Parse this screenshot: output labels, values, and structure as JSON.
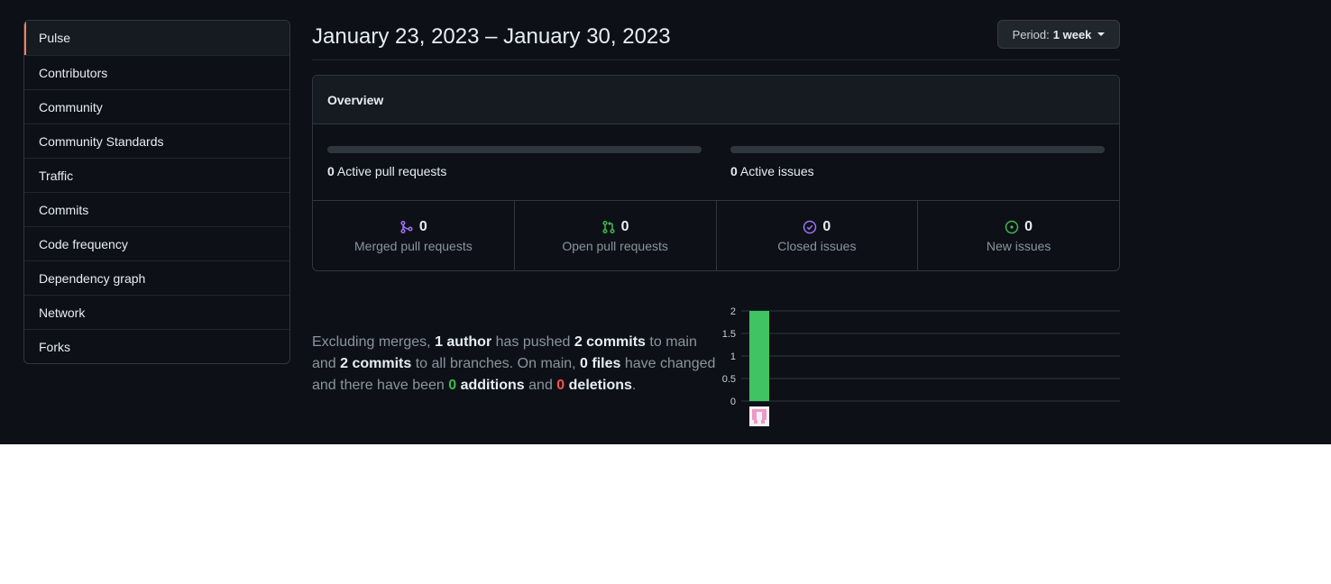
{
  "sidebar": {
    "items": [
      {
        "label": "Pulse"
      },
      {
        "label": "Contributors"
      },
      {
        "label": "Community"
      },
      {
        "label": "Community Standards"
      },
      {
        "label": "Traffic"
      },
      {
        "label": "Commits"
      },
      {
        "label": "Code frequency"
      },
      {
        "label": "Dependency graph"
      },
      {
        "label": "Network"
      },
      {
        "label": "Forks"
      }
    ],
    "selected": "Pulse"
  },
  "header": {
    "date_range": "January 23, 2023 – January 30, 2023",
    "period_label": "Period:",
    "period_value": "1 week"
  },
  "overview": {
    "title": "Overview",
    "active_prs_count": "0",
    "active_prs_label": "Active pull requests",
    "active_issues_count": "0",
    "active_issues_label": "Active issues",
    "stats": [
      {
        "count": "0",
        "label": "Merged pull requests",
        "icon": "git-merge-icon",
        "color": "#a371f7"
      },
      {
        "count": "0",
        "label": "Open pull requests",
        "icon": "git-pull-request-icon",
        "color": "#3fb950"
      },
      {
        "count": "0",
        "label": "Closed issues",
        "icon": "issue-closed-icon",
        "color": "#a371f7"
      },
      {
        "count": "0",
        "label": "New issues",
        "icon": "issue-opened-icon",
        "color": "#3fb950"
      }
    ]
  },
  "summary": {
    "t1": "Excluding merges, ",
    "authors": "1 author",
    "t2": " has pushed ",
    "commits_main": "2 commits",
    "t3": " to main and ",
    "commits_all": "2 commits",
    "t4": " to all branches. On main, ",
    "files": "0 files",
    "t5": " have changed and there have been ",
    "additions_num": "0",
    "additions_word": " additions",
    "t6": " and ",
    "deletions_num": "0",
    "deletions_word": " deletions",
    "t7": "."
  },
  "chart_data": {
    "type": "bar",
    "categories": [
      "author-1"
    ],
    "values": [
      2
    ],
    "ylim": [
      0,
      2
    ],
    "yticks": [
      "0",
      "0.5",
      "1",
      "1.5",
      "2"
    ],
    "grid": true,
    "bar_color": "#40c463",
    "title": "",
    "xlabel": "",
    "ylabel": ""
  }
}
